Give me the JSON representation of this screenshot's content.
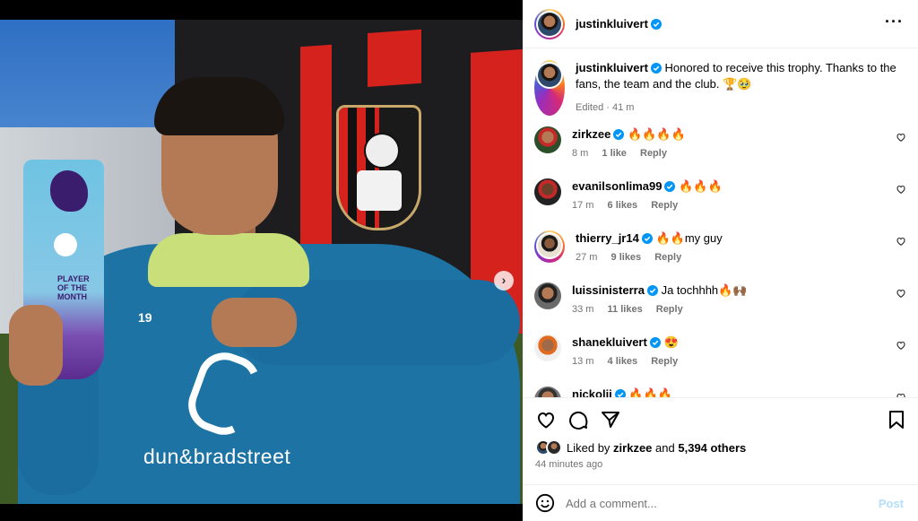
{
  "post": {
    "author": "justinkluivert",
    "caption": "Honored to receive this trophy. Thanks to the fans, the team and the club. 🏆🥹",
    "edited_meta": "Edited · 41 m"
  },
  "media": {
    "trophy_text": "PLAYER OF THE MONTH",
    "shirt_number": "19",
    "sponsor": "dun&bradstreet",
    "carousel_index": 0,
    "carousel_count": 3,
    "next_arrow": "›"
  },
  "comments": [
    {
      "user": "zirkzee",
      "text": "🔥🔥🔥🔥",
      "time": "8 m",
      "likes": "1 like",
      "reply": "Reply"
    },
    {
      "user": "evanilsonlima99",
      "text": "🔥🔥🔥",
      "time": "17 m",
      "likes": "6 likes",
      "reply": "Reply"
    },
    {
      "user": "thierry_jr14",
      "text": "🔥🔥my guy",
      "time": "27 m",
      "likes": "9 likes",
      "reply": "Reply"
    },
    {
      "user": "luissinisterra",
      "text": "Ja tochhhh🔥🙌🏾",
      "time": "33 m",
      "likes": "11 likes",
      "reply": "Reply"
    },
    {
      "user": "shanekluivert",
      "text": "😍",
      "time": "13 m",
      "likes": "4 likes",
      "reply": "Reply"
    },
    {
      "user": "nickolii",
      "text": "🔥🔥🔥",
      "time": "",
      "likes": "",
      "reply": ""
    }
  ],
  "footer": {
    "liked_by_prefix": "Liked by",
    "liked_by_user": "zirkzee",
    "liked_by_and": "and",
    "liked_by_others": "5,394 others",
    "time_ago": "44 minutes ago",
    "add_comment_placeholder": "Add a comment...",
    "post_label": "Post"
  },
  "icons": [
    "more-icon",
    "verified-icon",
    "heart-icon",
    "comment-icon",
    "share-icon",
    "save-icon",
    "emoji-icon"
  ],
  "colors": {
    "verified": "#0095f6",
    "post_disabled": "#b2dffc",
    "meta_grey": "#737373"
  }
}
